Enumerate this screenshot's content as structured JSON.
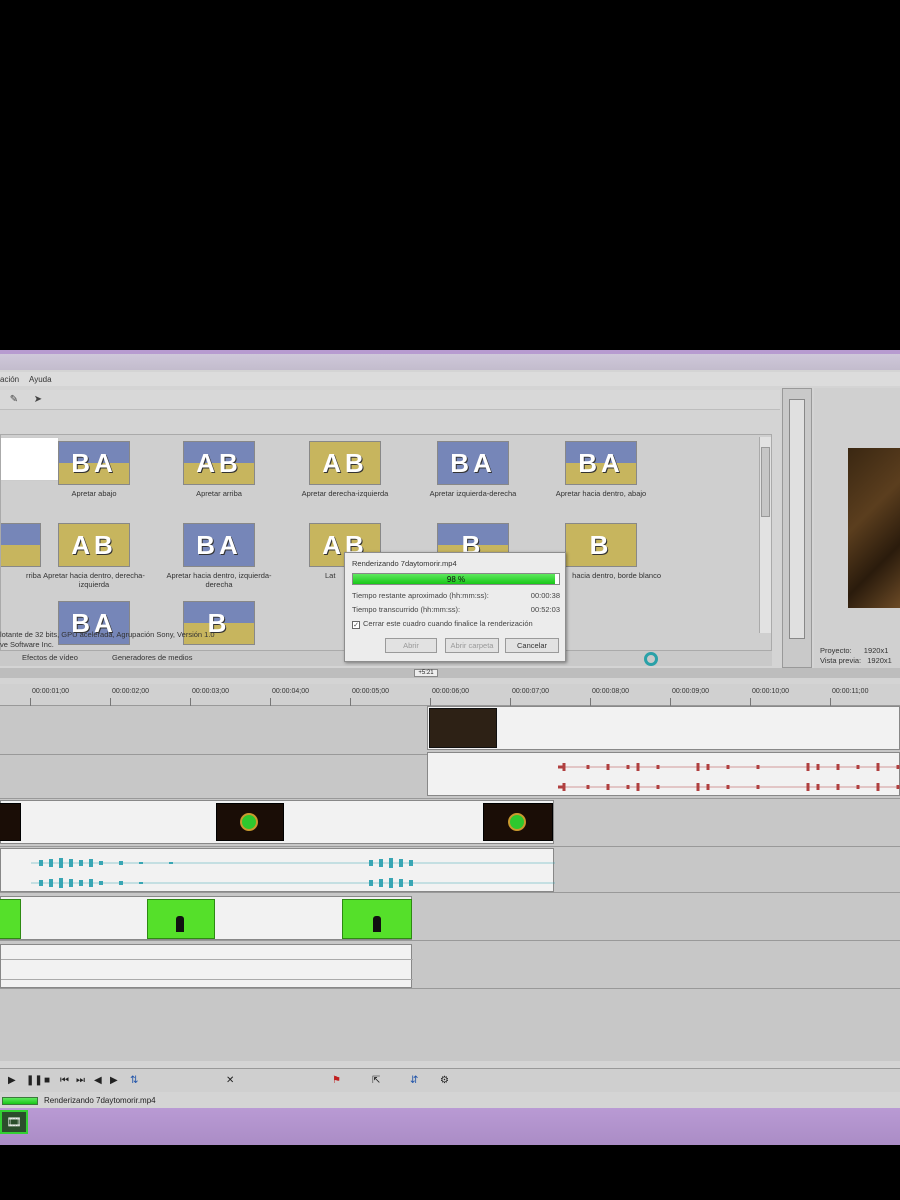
{
  "menu": {
    "partial_item": "ación",
    "help": "Ayuda"
  },
  "effects": [
    {
      "label": "Apretar abajo",
      "letters": "BA"
    },
    {
      "label": "Apretar arriba",
      "letters": "AB"
    },
    {
      "label": "Apretar derecha-izquierda",
      "letters": "AB"
    },
    {
      "label": "Apretar izquierda-derecha",
      "letters": "BA"
    },
    {
      "label": "Apretar hacia dentro, abajo",
      "letters": "BA"
    },
    {
      "label": "rriba",
      "letters": ""
    },
    {
      "label": "Apretar hacia dentro, derecha-izquierda",
      "letters": "AB"
    },
    {
      "label": "Apretar hacia dentro, izquierda-derecha",
      "letters": "BA"
    },
    {
      "label": "Lat",
      "letters": "AB"
    },
    {
      "label": "",
      "letters": "B"
    },
    {
      "label": "hacia dentro, borde blanco",
      "letters": "B"
    },
    {
      "label": "",
      "letters": "BA"
    },
    {
      "label": "",
      "letters": "B"
    }
  ],
  "info": {
    "line1": "lotante de 32 bits, GPU acelerada, Agrupación Sony, Versión 1.0",
    "line2": "ve Software Inc."
  },
  "tabs": {
    "video_fx": "Efectos de vídeo",
    "media_gen": "Generadores de medios"
  },
  "preview": {
    "project_label": "Proyecto:",
    "project_value": "1920x1",
    "preview_label": "Vista previa:",
    "preview_value": "1920x1"
  },
  "render_dialog": {
    "title": "Renderizando 7daytomorir.mp4",
    "progress_percent": 98,
    "progress_text": "98 %",
    "remaining_label": "Tiempo restante aproximado (hh:mm:ss):",
    "remaining_value": "00:00:38",
    "elapsed_label": "Tiempo transcurrido (hh:mm:ss):",
    "elapsed_value": "00:52:03",
    "close_checkbox_label": "Cerrar este cuadro cuando finalice la renderización",
    "close_checkbox_checked": true,
    "open_button": "Abrir",
    "open_folder_button": "Abrir carpeta",
    "cancel_button": "Cancelar"
  },
  "marker_position": "+5:21",
  "ruler_ticks": [
    "00:00:01;00",
    "00:00:02;00",
    "00:00:03;00",
    "00:00:04;00",
    "00:00:05;00",
    "00:00:06;00",
    "00:00:07;00",
    "00:00:08;00",
    "00:00:09;00",
    "00:00:10;00",
    "00:00:11;00"
  ],
  "status": {
    "render_text": "Renderizando 7daytomorir.mp4"
  },
  "colors": {
    "progress_green": "#18c818",
    "audio_red": "#b04040",
    "audio_teal": "#39a6b4",
    "chroma_green": "#55e02a"
  }
}
